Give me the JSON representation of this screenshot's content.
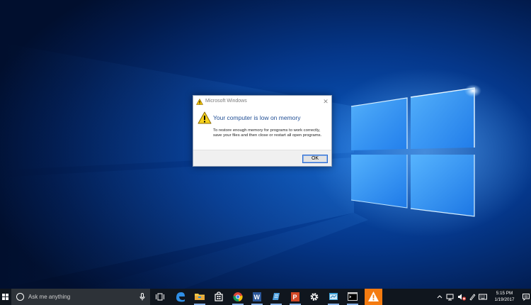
{
  "dialog": {
    "title": "Microsoft Windows",
    "close_glyph": "✕",
    "heading": "Your computer is low on memory",
    "message": "To restore enough memory for programs to work correctly, save your files and then close or restart all open programs.",
    "ok_label": "OK",
    "icon": "warning-icon"
  },
  "taskbar": {
    "search_placeholder": "Ask me anything",
    "time": "5:15 PM",
    "date": "1/19/2017",
    "apps": [
      "task-view",
      "edge",
      "file-explorer",
      "store",
      "chrome",
      "word",
      "app-blue",
      "powerpoint",
      "settings",
      "app-window",
      "command-prompt",
      "warning"
    ],
    "tray": [
      "chevron-up",
      "network",
      "volume-muted",
      "keyboard",
      "action-center"
    ]
  },
  "colors": {
    "taskbar": "#10161e",
    "search_box": "#2d3238",
    "dialog_heading": "#1f4d94",
    "ok_border": "#2a6ad0",
    "warning_app_bg": "#f47b10"
  }
}
